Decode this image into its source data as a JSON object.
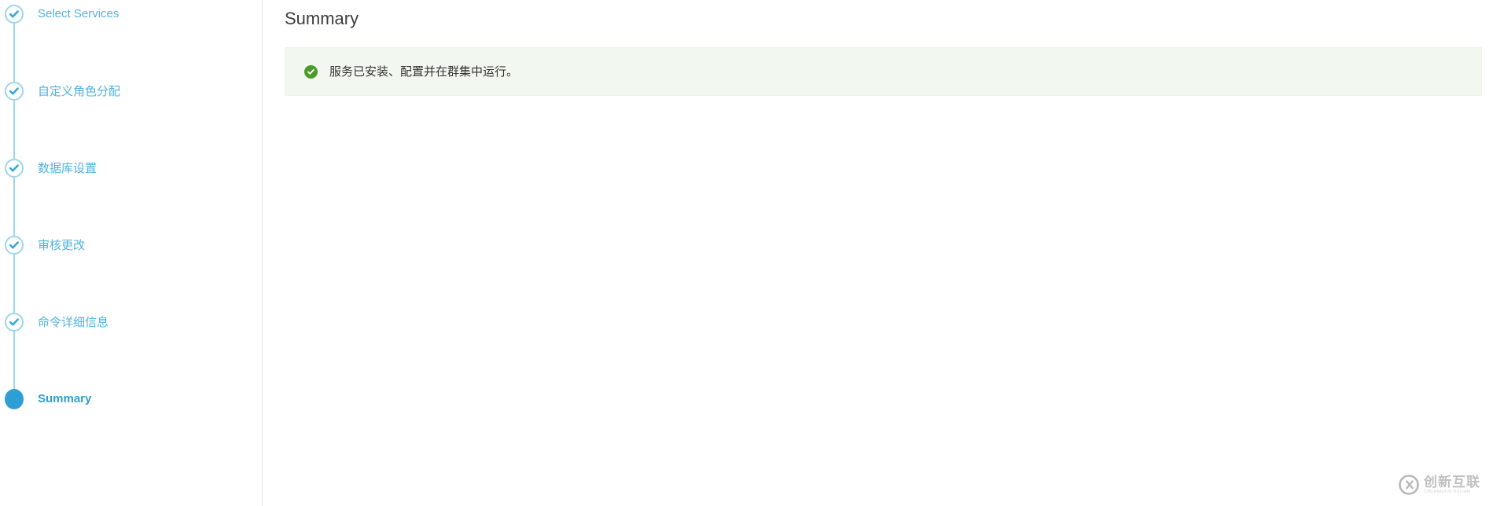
{
  "sidebar": {
    "steps": [
      {
        "label": "Select Services",
        "state": "completed",
        "icon": "check-circle-icon",
        "cjk": false
      },
      {
        "label": "自定义角色分配",
        "state": "completed",
        "icon": "check-circle-icon",
        "cjk": true
      },
      {
        "label": "数据库设置",
        "state": "completed",
        "icon": "check-circle-icon",
        "cjk": true
      },
      {
        "label": "审核更改",
        "state": "completed",
        "icon": "check-circle-icon",
        "cjk": true
      },
      {
        "label": "命令详细信息",
        "state": "completed",
        "icon": "check-circle-icon",
        "cjk": true
      },
      {
        "label": "Summary",
        "state": "active",
        "icon": "filled-circle-icon",
        "cjk": false
      }
    ]
  },
  "main": {
    "title": "Summary",
    "alert": {
      "type": "success",
      "icon": "check-circle-solid-icon",
      "message": "服务已安装、配置并在群集中运行。"
    }
  },
  "watermark": {
    "logo_icon": "cx-circle-logo-icon",
    "text": "创新互联",
    "subtext": "CHUANGXIN HULIAN"
  },
  "colors": {
    "accent": "#2e9fd4",
    "step_line": "#7ec8e8",
    "step_label": "#4fb3e0",
    "step_ring": "#9ed6ea",
    "alert_bg": "#f2f8ef",
    "alert_icon": "#4c9a2a",
    "title_text": "#3d3d3d",
    "divider": "#e4e6e8"
  }
}
